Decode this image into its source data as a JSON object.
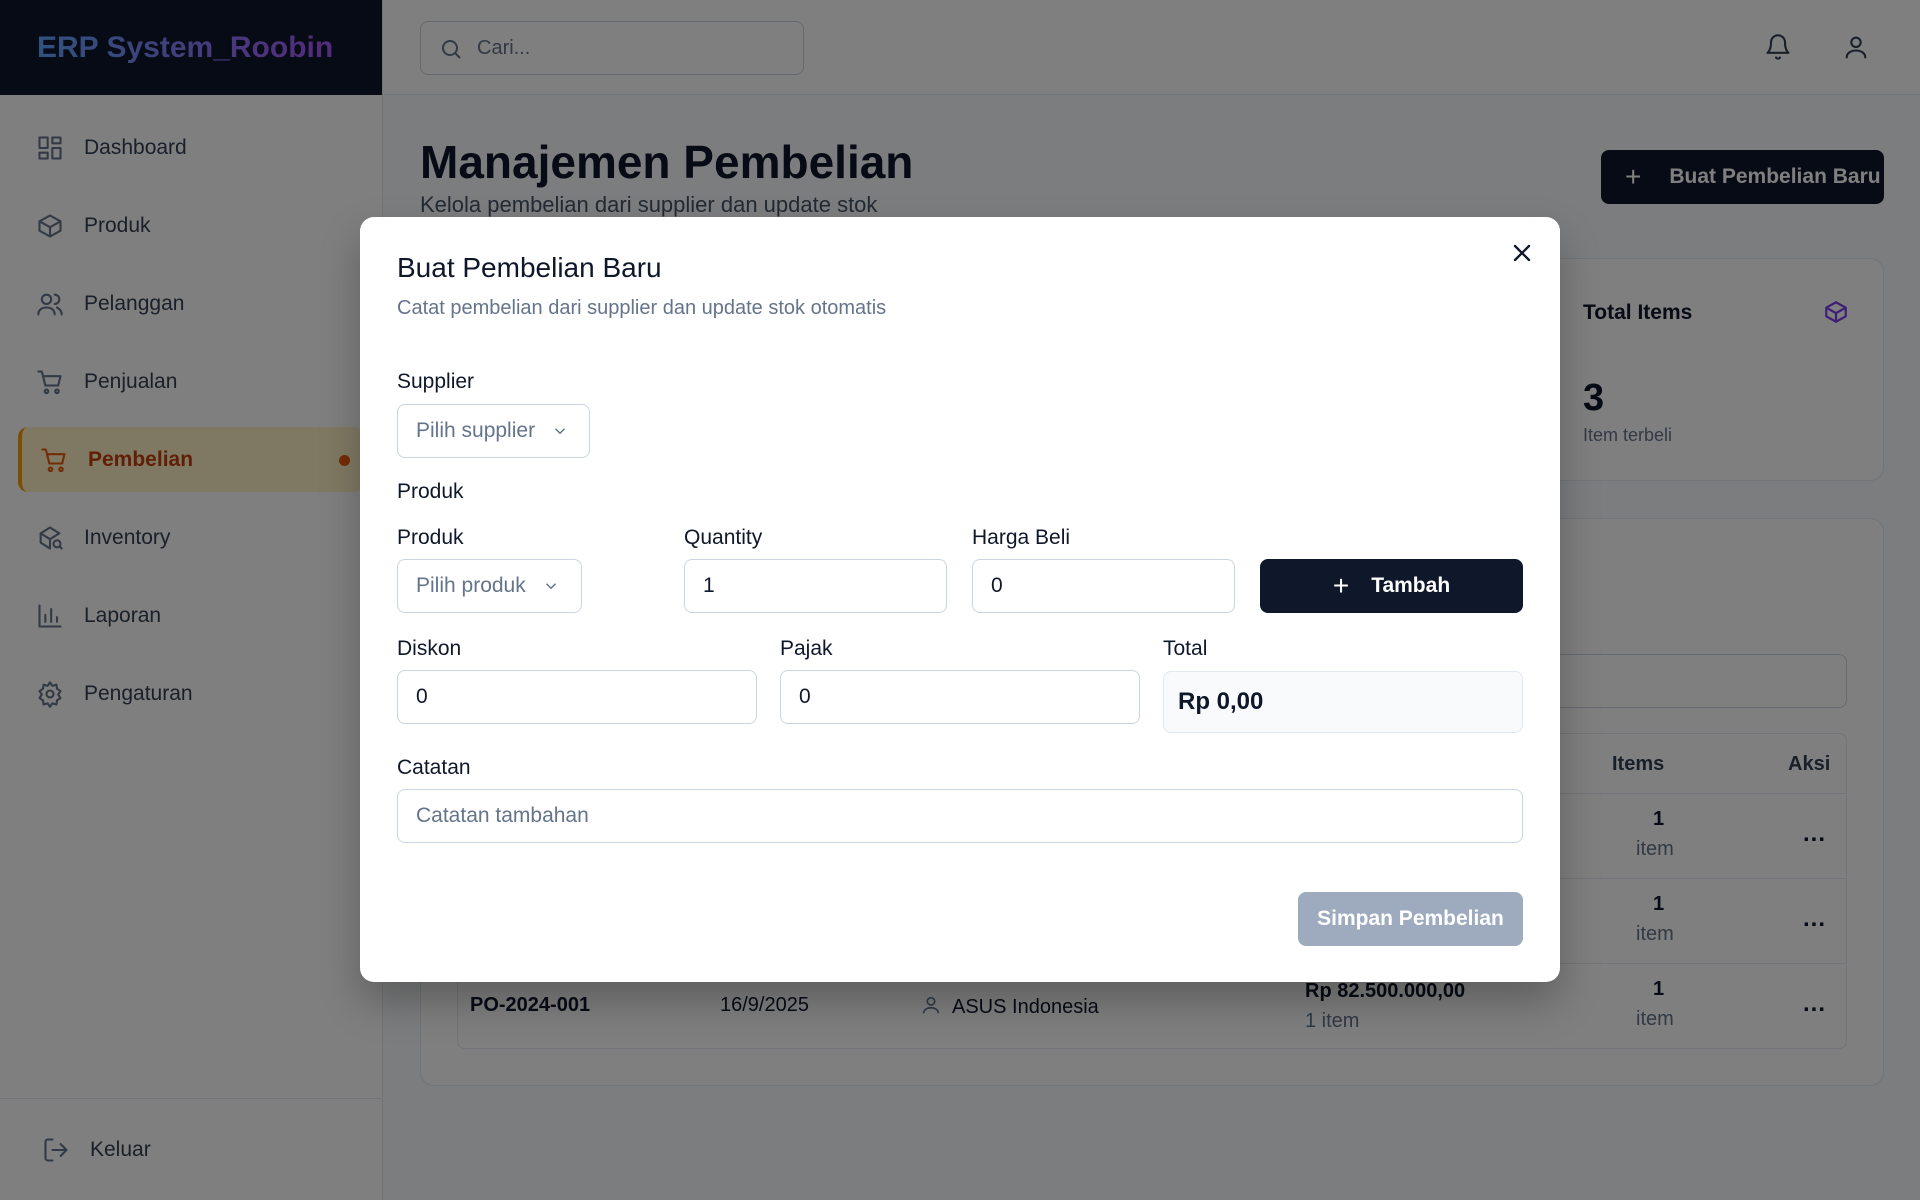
{
  "brand": "ERP System_Roobin",
  "sidebar": {
    "items": [
      {
        "label": "Dashboard"
      },
      {
        "label": "Produk"
      },
      {
        "label": "Pelanggan"
      },
      {
        "label": "Penjualan"
      },
      {
        "label": "Pembelian"
      },
      {
        "label": "Inventory"
      },
      {
        "label": "Laporan"
      },
      {
        "label": "Pengaturan"
      }
    ],
    "logout": "Keluar"
  },
  "header": {
    "search_placeholder": "Cari..."
  },
  "main": {
    "title": "Manajemen Pembelian",
    "subtitle": "Kelola pembelian dari supplier dan update stok",
    "new_button": "Buat Pembelian Baru",
    "stat": {
      "title": "Total Items",
      "value": "3",
      "desc": "Item terbeli"
    },
    "table": {
      "headers": {
        "items": "Items",
        "actions": "Aksi"
      },
      "rows": [
        {
          "items_count": "1",
          "items_unit": "item"
        },
        {
          "items_count": "1",
          "items_unit": "item"
        },
        {
          "po": "PO-2024-001",
          "date": "16/9/2025",
          "supplier": "ASUS Indonesia",
          "amount": "Rp 82.500.000,00",
          "amount_items": "1 item",
          "items_count": "1",
          "items_unit": "item"
        }
      ],
      "menu": "..."
    }
  },
  "modal": {
    "title": "Buat Pembelian Baru",
    "subtitle": "Catat pembelian dari supplier dan update stok otomatis",
    "supplier_label": "Supplier",
    "supplier_placeholder": "Pilih supplier",
    "product_section": "Produk",
    "product_label": "Produk",
    "product_placeholder": "Pilih produk",
    "quantity_label": "Quantity",
    "quantity_value": "1",
    "price_label": "Harga Beli",
    "price_value": "0",
    "add_button": "Tambah",
    "discount_label": "Diskon",
    "discount_value": "0",
    "tax_label": "Pajak",
    "tax_value": "0",
    "total_label": "Total",
    "total_value": "Rp 0,00",
    "notes_label": "Catatan",
    "notes_placeholder": "Catatan tambahan",
    "save_button": "Simpan Pembelian"
  }
}
